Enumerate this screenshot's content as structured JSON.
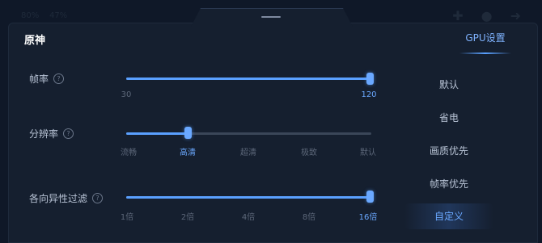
{
  "status_bar": {
    "left_text_1": "80%",
    "left_text_2": "47%"
  },
  "header": {
    "game_title": "原神",
    "tab_label": "GPU设置"
  },
  "settings": {
    "frame_rate": {
      "label": "帧率",
      "help_icon": "question-icon",
      "min_label": "30",
      "max_label": "120",
      "value": 120
    },
    "resolution": {
      "label": "分辨率",
      "help_icon": "question-icon",
      "options": [
        "流畅",
        "高清",
        "超清",
        "极致",
        "默认"
      ],
      "selected_index": 1
    },
    "anisotropic": {
      "label": "各向异性过滤",
      "help_icon": "question-icon",
      "options": [
        "1倍",
        "2倍",
        "4倍",
        "8倍",
        "16倍"
      ],
      "selected_index": 4
    }
  },
  "presets": {
    "items": [
      "默认",
      "省电",
      "画质优先",
      "帧率优先",
      "自定义"
    ],
    "selected": "自定义"
  },
  "colors": {
    "accent": "#5aa0ff",
    "background": "#151f2f",
    "track": "#3a4658"
  }
}
